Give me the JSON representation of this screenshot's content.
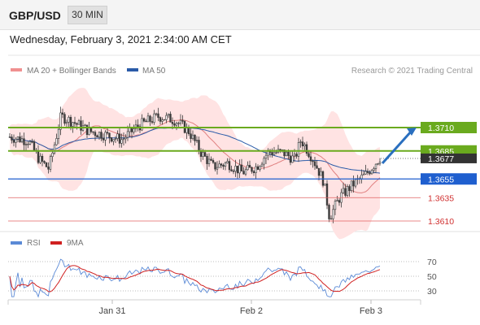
{
  "header": {
    "symbol": "GBP/USD",
    "timeframe": "30 MIN",
    "datetime": "Wednesday, February 3, 2021 2:34:00 AM CET"
  },
  "legend": {
    "ma20_label": "MA 20 + Bollinger Bands",
    "ma50_label": "MA 50",
    "copyright": "Research © 2021 Trading Central",
    "rsi_label": "RSI",
    "rsi_ma_label": "9MA"
  },
  "colors": {
    "candle": "#3a3a3a",
    "bollinger_fill": "#ffe3e3",
    "ma20": "#e08080",
    "ma50": "#2a5ba8",
    "resistance": "#6aaa1e",
    "pivot": "#1f5fcf",
    "support": "#e06060",
    "arrow": "#2a6fbf",
    "price_tag": "#333333",
    "rsi": "#5b8ad6",
    "rsi_ma": "#d02020"
  },
  "chart_data": [
    {
      "type": "candlestick",
      "title": "GBP/USD",
      "timeframe": "30 MIN",
      "x_labels": [
        "Jan 31",
        "Feb 2",
        "Feb 3"
      ],
      "ylim": [
        1.3598,
        1.3748
      ],
      "price_tag_value": "1.3677",
      "levels": [
        {
          "value": 1.371,
          "label": "1.3710",
          "kind": "resistance"
        },
        {
          "value": 1.3685,
          "label": "1.3685",
          "kind": "resistance"
        },
        {
          "value": 1.3655,
          "label": "1.3655",
          "kind": "pivot"
        },
        {
          "value": 1.3635,
          "label": "1.3635",
          "kind": "support"
        },
        {
          "value": 1.361,
          "label": "1.3610",
          "kind": "support"
        }
      ],
      "forecast": {
        "from": 1.3677,
        "to": 1.371,
        "direction": "up"
      },
      "series": [
        {
          "name": "MA 20 + Bollinger Bands"
        },
        {
          "name": "MA 50"
        }
      ]
    },
    {
      "type": "line",
      "title": "RSI",
      "ylim": [
        20,
        80
      ],
      "y_ticks": [
        "70",
        "50",
        "30"
      ],
      "series": [
        {
          "name": "RSI"
        },
        {
          "name": "9MA"
        }
      ]
    }
  ]
}
